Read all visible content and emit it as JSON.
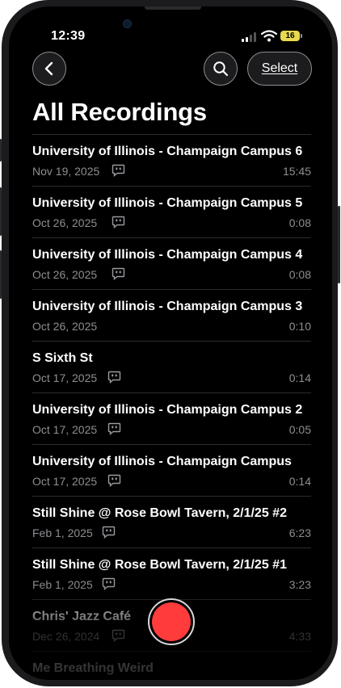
{
  "status_bar": {
    "time": "12:39",
    "battery": "16"
  },
  "header": {
    "select_label": "Select",
    "title": "All Recordings"
  },
  "colors": {
    "record": "#ff3b3b",
    "battery": "#e8d94e",
    "secondary_text": "#8e8e93"
  },
  "icons": {
    "back": "chevron-left-icon",
    "search": "search-icon",
    "transcript": "transcript-bubble-icon"
  },
  "recordings": [
    {
      "name": "University of Illinois - Champaign Campus 6",
      "date": "Nov 19, 2025",
      "duration": "15:45",
      "transcript": true
    },
    {
      "name": "University of Illinois - Champaign Campus 5",
      "date": "Oct 26, 2025",
      "duration": "0:08",
      "transcript": true
    },
    {
      "name": "University of Illinois - Champaign Campus 4",
      "date": "Oct 26, 2025",
      "duration": "0:08",
      "transcript": true
    },
    {
      "name": "University of Illinois - Champaign Campus 3",
      "date": "Oct 26, 2025",
      "duration": "0:10",
      "transcript": false
    },
    {
      "name": "S Sixth St",
      "date": "Oct 17, 2025",
      "duration": "0:14",
      "transcript": true
    },
    {
      "name": "University of Illinois - Champaign Campus 2",
      "date": "Oct 17, 2025",
      "duration": "0:05",
      "transcript": true
    },
    {
      "name": "University of Illinois - Champaign Campus",
      "date": "Oct 17, 2025",
      "duration": "0:14",
      "transcript": true
    },
    {
      "name": "Still Shine @ Rose Bowl Tavern, 2/1/25 #2",
      "date": "Feb 1, 2025",
      "duration": "6:23",
      "transcript": true
    },
    {
      "name": "Still Shine @ Rose Bowl Tavern, 2/1/25 #1",
      "date": "Feb 1, 2025",
      "duration": "3:23",
      "transcript": true
    },
    {
      "name": "Chris' Jazz Café",
      "date": "Dec 26, 2024",
      "duration": "4:33",
      "transcript": true
    },
    {
      "name": "Me Breathing Weird",
      "date": "",
      "duration": "",
      "transcript": false
    }
  ]
}
